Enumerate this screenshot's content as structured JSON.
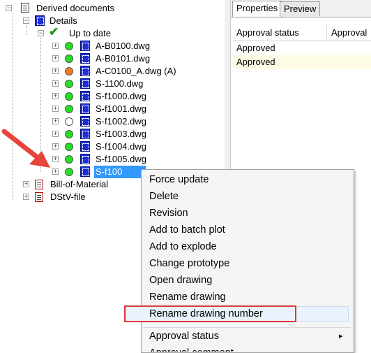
{
  "tree": {
    "root": "Derived documents",
    "details": "Details",
    "uptodate": "Up to date",
    "files": [
      {
        "name": "A-B0100.dwg",
        "status": "green"
      },
      {
        "name": "A-B0101.dwg",
        "status": "green"
      },
      {
        "name": "A-C0100_A.dwg (A)",
        "status": "orange"
      },
      {
        "name": "S-1100.dwg",
        "status": "green"
      },
      {
        "name": "S-f1000.dwg",
        "status": "green"
      },
      {
        "name": "S-f1001.dwg",
        "status": "green"
      },
      {
        "name": "S-f1002.dwg",
        "status": "white"
      },
      {
        "name": "S-f1003.dwg",
        "status": "green"
      },
      {
        "name": "S-f1004.dwg",
        "status": "green"
      },
      {
        "name": "S-f1005.dwg",
        "status": "green"
      },
      {
        "name": "S-f100",
        "status": "green"
      }
    ],
    "bom": "Bill-of-Material",
    "dstv": "DStV-file"
  },
  "panel": {
    "tab_properties": "Properties",
    "tab_preview": "Preview",
    "col1": "Approval status",
    "col2": "Approval",
    "rows": [
      "Approved",
      "Approved"
    ]
  },
  "menu": {
    "items": [
      "Force update",
      "Delete",
      "Revision",
      "Add to batch plot",
      "Add to explode",
      "Change prototype",
      "Open drawing",
      "Rename drawing",
      "Rename drawing number",
      "Approval status",
      "Approval comment"
    ],
    "submenu_arrow": "▸"
  },
  "colors": {
    "green": "#22e022",
    "orange": "#f07a20",
    "white": "#ffffff",
    "highlight": "#e03838",
    "arrow": "#e8443a",
    "selection": "#3399ff"
  }
}
